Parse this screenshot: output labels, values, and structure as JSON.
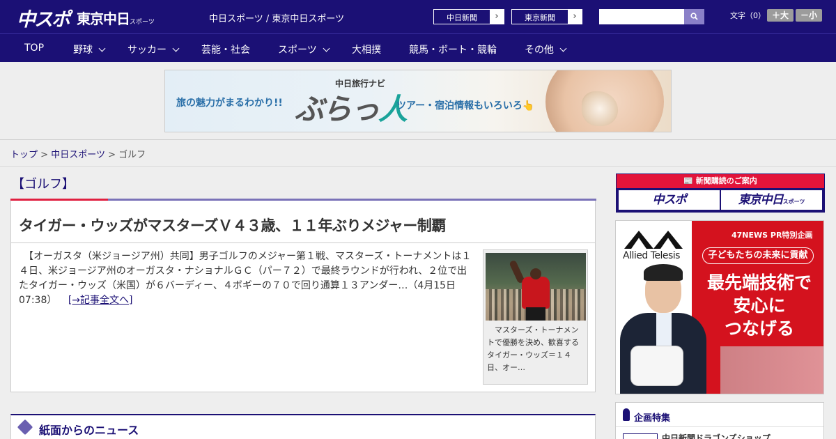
{
  "header": {
    "logo_chuspo": "中スポ",
    "logo_tokyo": "東京中日",
    "logo_tokyo_small": "スポーツ",
    "site_name": "中日スポーツ / 東京中日スポーツ",
    "sister_sites": [
      {
        "label": "中日新聞",
        "arrow": "›"
      },
      {
        "label": "東京新聞",
        "arrow": "›"
      }
    ],
    "search": {
      "value": "",
      "placeholder": "",
      "icon": "search-icon"
    },
    "font_size_label": "文字（0）",
    "font_larger": "＋大",
    "font_smaller": "－小"
  },
  "nav": {
    "items": [
      {
        "label": "TOP",
        "dropdown": false
      },
      {
        "label": "野球",
        "dropdown": true
      },
      {
        "label": "サッカー",
        "dropdown": true
      },
      {
        "label": "芸能・社会",
        "dropdown": false
      },
      {
        "label": "スポーツ",
        "dropdown": true
      },
      {
        "label": "大相撲",
        "dropdown": false
      },
      {
        "label": "競馬・ボート・競輪",
        "dropdown": false
      },
      {
        "label": "その他",
        "dropdown": true
      }
    ]
  },
  "ad_banner": {
    "text_left": "旅の魅力がまるわかり!!",
    "subtitle": "中日旅行ナビ",
    "brand_a": "ぶらっ",
    "brand_b": "人",
    "text_right": "ツアー・宿泊情報もいろいろ👆"
  },
  "breadcrumb": {
    "items": [
      "トップ",
      "中日スポーツ"
    ],
    "current": "ゴルフ",
    "separator": ">"
  },
  "main": {
    "category": "【ゴルフ】",
    "article": {
      "headline": "タイガー・ウッズがマスターズＶ４３歳、１１年ぶりメジャー制覇",
      "body": "　【オーガスタ（米ジョージア州）共同】男子ゴルフのメジャー第１戦、マスターズ・トーナメントは１４日、米ジョージア州のオーガスタ・ナショナルＧＣ（パー７２）で最終ラウンドが行われ、２位で出たタイガー・ウッズ（米国）が６バーディー、４ボギーの７０で回り通算１３アンダー…（4月15日 07:38）",
      "more_link": "[→記事全文へ]",
      "photo_caption": "　マスターズ・トーナメントで優勝を決め、歓喜するタイガー・ウッズ＝１４日、オー…"
    },
    "news_section_title": "紙面からのニュース"
  },
  "sidebar": {
    "subscribe_header": "📰 新聞購読のご案内",
    "subscribe_buttons": [
      {
        "label": "中スポ",
        "small": ""
      },
      {
        "label": "東京中日",
        "small": "スポーツ"
      }
    ],
    "ad": {
      "company": "Allied Telesis",
      "pr_label": "47NEWS PR特別企画",
      "tagline": "子どもたちの未来に貢献",
      "headline_lines": [
        "最先端技術で",
        "安心に",
        "つなげる"
      ]
    },
    "plan_title": "企画特集",
    "plan_item": "中日新聞ドラゴンズショップ"
  },
  "colors": {
    "brand_navy": "#1b1075",
    "accent_red": "#e02040",
    "background": "#eeeeee"
  }
}
